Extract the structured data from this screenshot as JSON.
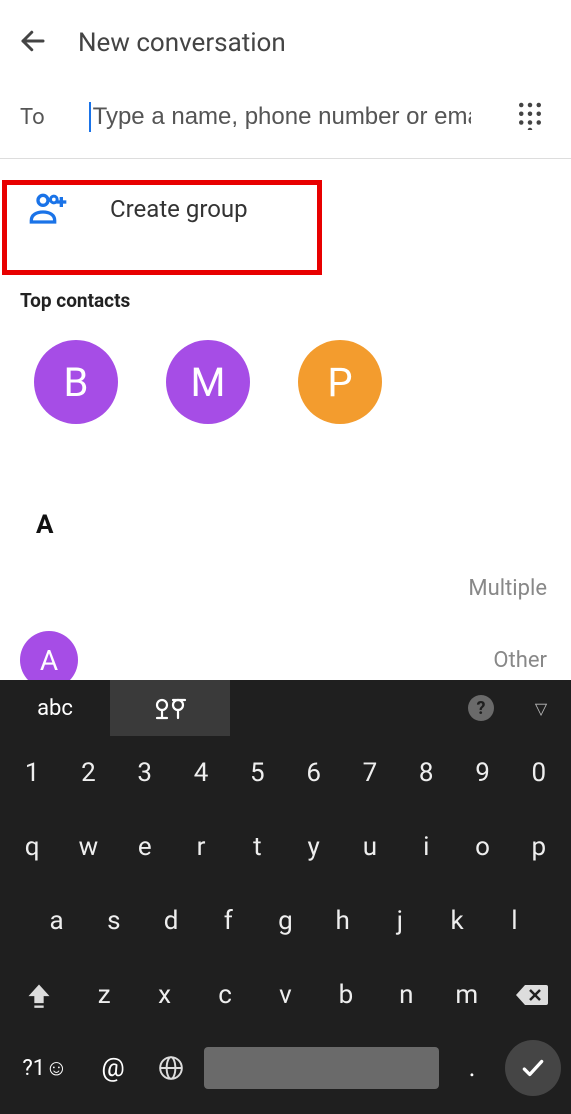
{
  "header": {
    "title": "New conversation"
  },
  "to": {
    "label": "To",
    "placeholder": "Type a name, phone number or email…"
  },
  "create_group": {
    "label": "Create group"
  },
  "top_contacts": {
    "label": "Top contacts",
    "items": [
      {
        "initial": "B",
        "color": "purple"
      },
      {
        "initial": "M",
        "color": "purple"
      },
      {
        "initial": "P",
        "color": "orange"
      }
    ]
  },
  "index_header": "A",
  "contacts": [
    {
      "meta": "Multiple"
    },
    {
      "initial": "A",
      "color": "purple",
      "meta": "Other"
    }
  ],
  "keyboard": {
    "mode": "abc",
    "lang_glyph": "ಠ",
    "help": "?",
    "collapse": "▽",
    "row_num": [
      "1",
      "2",
      "3",
      "4",
      "5",
      "6",
      "7",
      "8",
      "9",
      "0"
    ],
    "row1": [
      "q",
      "w",
      "e",
      "r",
      "t",
      "y",
      "u",
      "i",
      "o",
      "p"
    ],
    "row2": [
      "a",
      "s",
      "d",
      "f",
      "g",
      "h",
      "j",
      "k",
      "l"
    ],
    "row3": [
      "z",
      "x",
      "c",
      "v",
      "b",
      "n",
      "m"
    ],
    "symbols_label": "?1☺",
    "at": "@",
    "dot": "."
  }
}
